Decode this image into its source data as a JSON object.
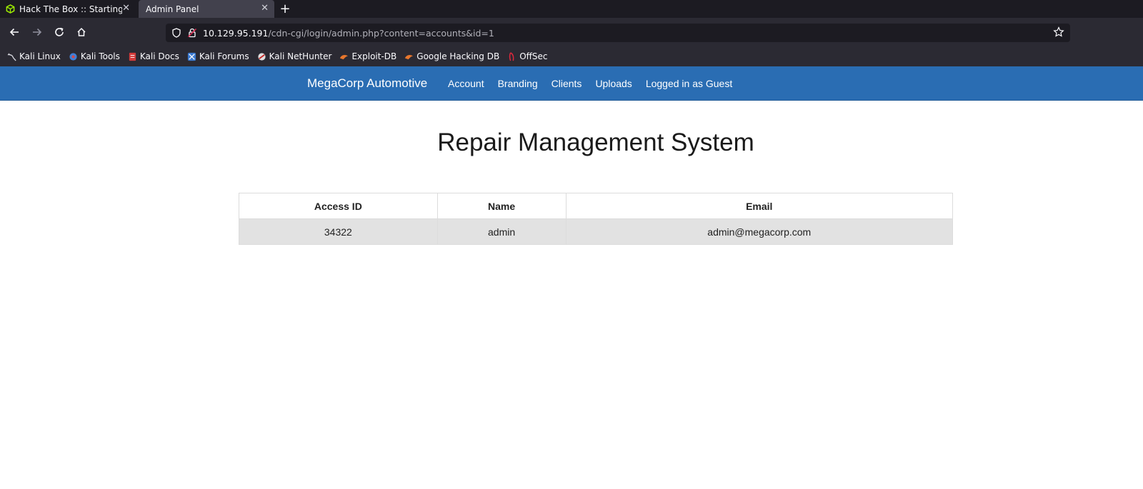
{
  "browser": {
    "tabs": [
      {
        "title": "Hack The Box :: Starting P",
        "active": false,
        "favicon": "htb-cube-icon"
      },
      {
        "title": "Admin Panel",
        "active": true
      }
    ],
    "new_tab_label": "+",
    "url_host": "10.129.95.191",
    "url_path": "/cdn-cgi/login/admin.php?content=accounts&id=1",
    "bookmarks": [
      {
        "label": "Kali Linux",
        "icon": "kali-dragon-icon"
      },
      {
        "label": "Kali Tools",
        "icon": "kali-tools-icon"
      },
      {
        "label": "Kali Docs",
        "icon": "kali-docs-icon"
      },
      {
        "label": "Kali Forums",
        "icon": "kali-forums-icon"
      },
      {
        "label": "Kali NetHunter",
        "icon": "nethunter-icon"
      },
      {
        "label": "Exploit-DB",
        "icon": "exploit-db-icon"
      },
      {
        "label": "Google Hacking DB",
        "icon": "ghdb-icon"
      },
      {
        "label": "OffSec",
        "icon": "offsec-icon"
      }
    ]
  },
  "site": {
    "brand": "MegaCorp Automotive",
    "nav": [
      "Account",
      "Branding",
      "Clients",
      "Uploads",
      "Logged in as Guest"
    ],
    "nav_color": "#2a6db3"
  },
  "main": {
    "title": "Repair Management System",
    "table": {
      "headers": [
        "Access ID",
        "Name",
        "Email"
      ],
      "rows": [
        [
          "34322",
          "admin",
          "admin@megacorp.com"
        ]
      ]
    }
  }
}
